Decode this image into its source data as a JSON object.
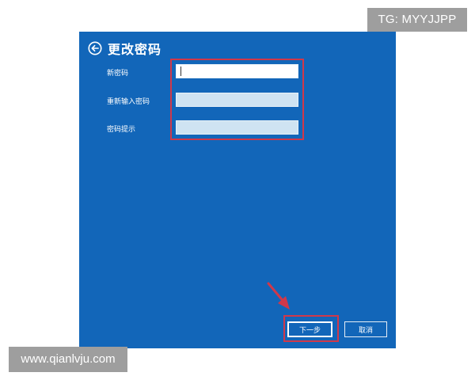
{
  "watermarks": {
    "top": "TG: MYYJJPP",
    "bottom": "www.qianlvju.com"
  },
  "dialog": {
    "title": "更改密码",
    "back_icon": "back-arrow-circle-icon",
    "fields": [
      {
        "label": "新密码",
        "value": ""
      },
      {
        "label": "重新输入密码",
        "value": ""
      },
      {
        "label": "密码提示",
        "value": ""
      }
    ],
    "buttons": {
      "next": "下一步",
      "cancel": "取消"
    }
  },
  "colors": {
    "dialog_bg": "#1266b9",
    "highlight": "#d0384a",
    "watermark_bg": "#9e9e9e"
  }
}
